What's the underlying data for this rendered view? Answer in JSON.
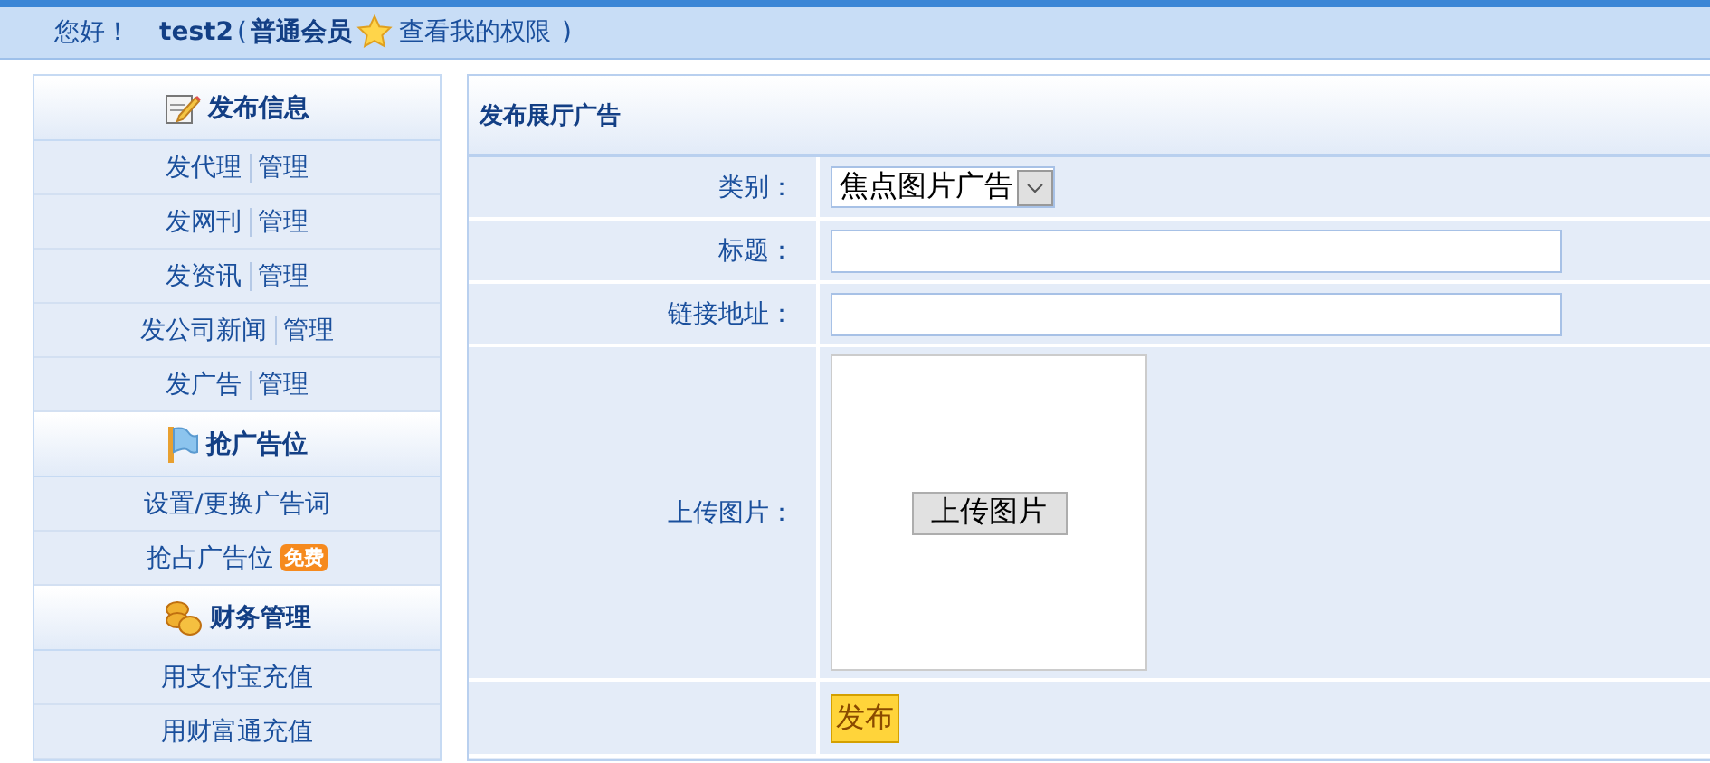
{
  "top_bar": {
    "greeting": "您好！",
    "username": "test2",
    "level_open": "(",
    "level": "普通会员",
    "permissions_link": "查看我的权限",
    "level_close": ")"
  },
  "sidebar": {
    "sections": [
      {
        "title": "发布信息",
        "items": [
          {
            "label": "发代理",
            "manage": "管理"
          },
          {
            "label": "发网刊",
            "manage": "管理"
          },
          {
            "label": "发资讯",
            "manage": "管理"
          },
          {
            "label": "发公司新闻",
            "manage": "管理"
          },
          {
            "label": "发广告",
            "manage": "管理"
          }
        ]
      },
      {
        "title": "抢广告位",
        "items": [
          {
            "label": "设置/更换广告词"
          },
          {
            "label": "抢占广告位",
            "badge": "免费"
          }
        ]
      },
      {
        "title": "财务管理",
        "items": [
          {
            "label": "用支付宝充值"
          },
          {
            "label": "用财富通充值"
          }
        ]
      }
    ]
  },
  "form": {
    "title": "发布展厅广告",
    "rows": [
      {
        "kind": "select",
        "label": "类别：",
        "value": "焦点图片广告"
      },
      {
        "kind": "text",
        "label": "标题："
      },
      {
        "kind": "text",
        "label": "链接地址："
      },
      {
        "kind": "upload",
        "label": "上传图片：",
        "button": "上传图片"
      },
      {
        "kind": "submit",
        "button": "发布"
      }
    ]
  }
}
